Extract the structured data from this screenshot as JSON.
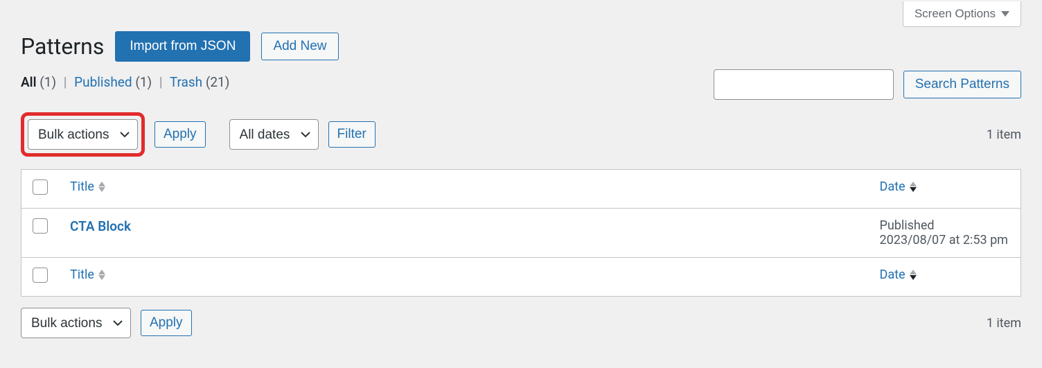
{
  "screen_options_label": "Screen Options",
  "page_title": "Patterns",
  "buttons": {
    "import_json": "Import from JSON",
    "add_new": "Add New",
    "apply": "Apply",
    "filter": "Filter",
    "search": "Search Patterns"
  },
  "filters": {
    "all": {
      "label": "All",
      "count": "(1)"
    },
    "published": {
      "label": "Published",
      "count": "(1)"
    },
    "trash": {
      "label": "Trash",
      "count": "(21)"
    }
  },
  "selects": {
    "bulk_actions": "Bulk actions",
    "all_dates": "All dates"
  },
  "item_count": "1 item",
  "columns": {
    "title": "Title",
    "date": "Date"
  },
  "rows": [
    {
      "title": "CTA Block",
      "status": "Published",
      "date_line": "2023/08/07 at 2:53 pm"
    }
  ]
}
